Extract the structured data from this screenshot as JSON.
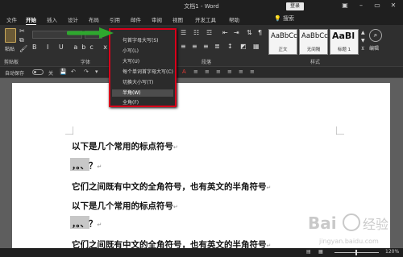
{
  "window": {
    "title": "文档1 - Word",
    "login_label": "登录",
    "minimize": "–",
    "restore": "▭",
    "close": "✕"
  },
  "tabs": [
    "文件",
    "开始",
    "插入",
    "设计",
    "布局",
    "引用",
    "邮件",
    "审阅",
    "视图",
    "开发工具",
    "帮助"
  ],
  "tell_me_icon": "lightbulb-icon",
  "tell_me": "搜索",
  "ribbon": {
    "paste_label": "粘贴",
    "groups": {
      "clipboard": "剪贴板",
      "font": "字体",
      "paragraph": "段落",
      "styles": "样式",
      "editing": "编辑"
    },
    "case_button": "Aa",
    "format_buttons": "B I U abc x₂ x² A",
    "styles": [
      {
        "sample": "AaBbCc",
        "name": "正文"
      },
      {
        "sample": "AaBbCc",
        "name": "无间隔"
      },
      {
        "sample": "AaBl",
        "name": "标题 1"
      }
    ],
    "edit_label": "编辑"
  },
  "qat": {
    "autosave": "自动保存",
    "toggle_state": "关"
  },
  "case_menu": {
    "items": [
      "句首字母大写(S)",
      "小写(L)",
      "大写(U)",
      "每个单词首字母大写(C)",
      "切换大小写(T)",
      "半角(W)",
      "全角(F)"
    ],
    "highlighted_index": 5
  },
  "document": {
    "lines": [
      "以下是几个常用的标点符号",
      "，。、？",
      "它们之间既有中文的全角符号，也有英文的半角符号",
      "以下是几个常用的标点符号",
      "，。、？",
      "它们之间既有中文的全角符号，也有英文的半角符号"
    ],
    "paragraph_mark": "↵"
  },
  "statusbar": {
    "zoom": "120%"
  },
  "watermark": {
    "text": "Bai 经验",
    "url": "jingyan.baidu.com"
  },
  "colors": {
    "highlight_box": "#d9001b",
    "arrow": "#2ea82e",
    "selection": "#c7c7c7"
  }
}
